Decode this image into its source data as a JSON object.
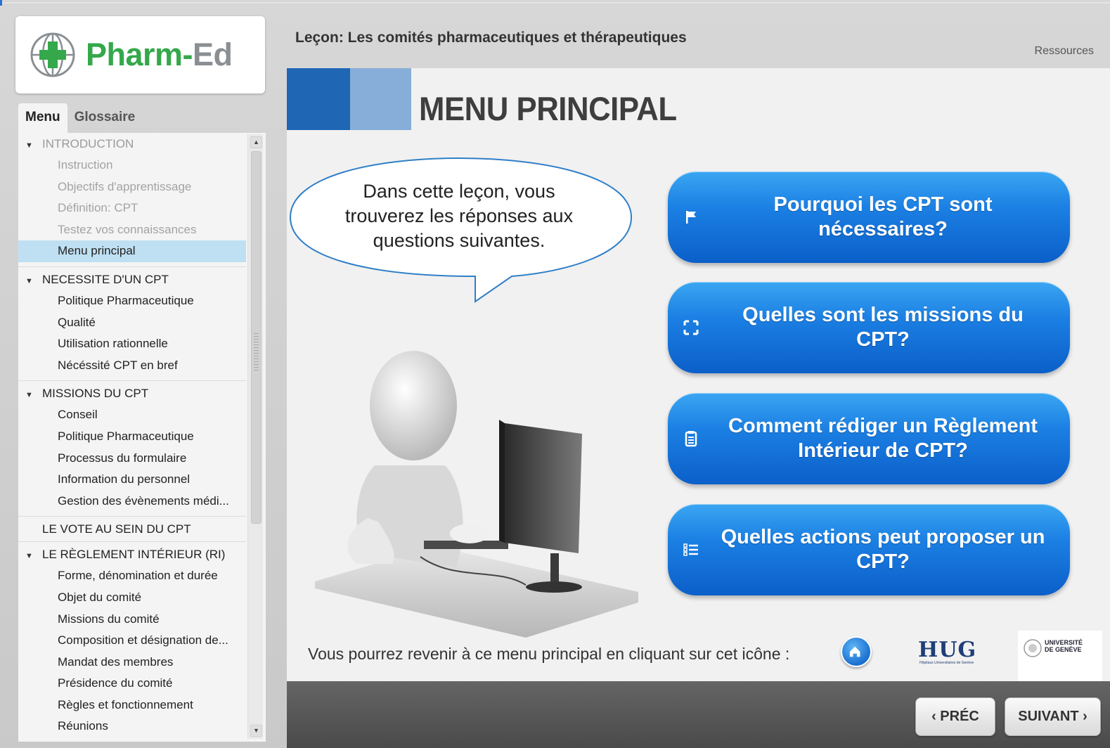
{
  "app": {
    "logo_text_green": "Pharm-",
    "logo_text_gray": "Ed",
    "lesson_title": "Leçon: Les comités pharmaceutiques et thérapeutiques",
    "resources_label": "Ressources"
  },
  "sidebar": {
    "tabs": [
      {
        "label": "Menu",
        "active": true
      },
      {
        "label": "Glossaire",
        "active": false
      }
    ],
    "sections": [
      {
        "title": "INTRODUCTION",
        "items": [
          "Instruction",
          "Objectifs d'apprentissage",
          "Définition: CPT",
          "Testez vos connaissances",
          "Menu principal"
        ]
      },
      {
        "title": "NECESSITE D'UN CPT",
        "items": [
          "Politique Pharmaceutique",
          "Qualité",
          "Utilisation rationnelle",
          "Nécéssité CPT en bref"
        ]
      },
      {
        "title": "MISSIONS DU CPT",
        "items": [
          "Conseil",
          "Politique Pharmaceutique",
          "Processus du formulaire",
          "Information du personnel",
          "Gestion des évènements médi..."
        ]
      },
      {
        "title": "LE VOTE AU SEIN DU CPT",
        "items": []
      },
      {
        "title": "LE RÈGLEMENT INTÉRIEUR (RI)",
        "items": [
          "Forme, dénomination et durée",
          "Objet du comité",
          "Missions du comité",
          "Composition et désignation de...",
          "Mandat des membres",
          "Présidence du comité",
          "Règles et fonctionnement",
          "Réunions"
        ]
      }
    ],
    "selected_item": "Menu principal"
  },
  "main": {
    "title": "MENU PRINCIPAL",
    "bubble_text_lines": [
      "Dans cette leçon, vous",
      "trouverez les réponses aux",
      "questions suivantes."
    ],
    "questions": [
      {
        "icon": "flag-icon",
        "lines": [
          "Pourquoi les CPT sont",
          "nécessaires?"
        ]
      },
      {
        "icon": "expand-icon",
        "lines": [
          "Quelles sont les missions du",
          "CPT?"
        ]
      },
      {
        "icon": "clipboard-icon",
        "lines": [
          "Comment rédiger un Règlement",
          "Intérieur de CPT?"
        ]
      },
      {
        "icon": "list-icon",
        "lines": [
          "Quelles actions peut proposer un",
          "CPT?"
        ]
      }
    ],
    "footer_text": "Vous pourrez revenir à ce menu principal en cliquant sur cet icône :",
    "hug_logo": "HUG",
    "hug_sub": "Hôpitaux Universitaires de Genève",
    "unige_lines": [
      "UNIVERSITÉ",
      "DE GENÈVE"
    ]
  },
  "nav": {
    "prev_label": "‹ PRÉC",
    "next_label": "SUIVANT ›"
  },
  "colors": {
    "brand_green": "#34a84b",
    "button_blue": "#1b7fe3",
    "header_block_dark": "#1f66b5",
    "header_block_light": "#87aed8",
    "selected_item_bg": "#bfe0f2"
  }
}
